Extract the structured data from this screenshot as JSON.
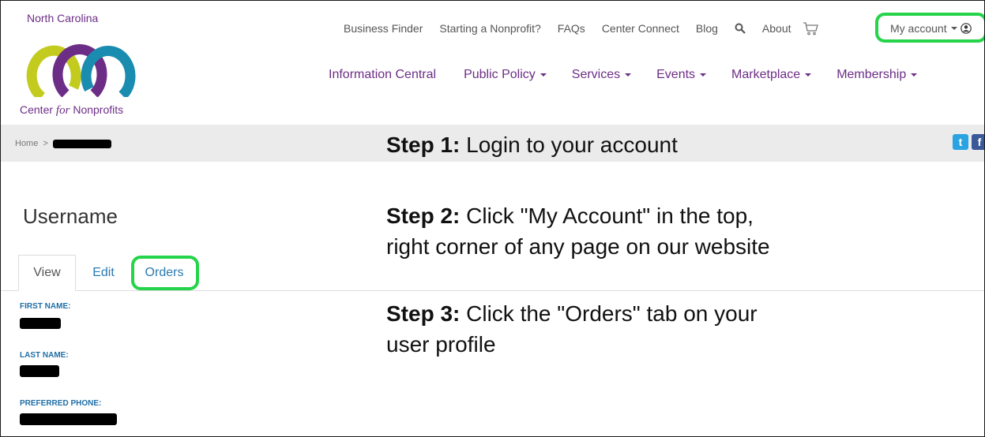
{
  "logo": {
    "top_text": "North Carolina",
    "bottom_prefix": "Center ",
    "bottom_italic": "for",
    "bottom_suffix": " Nonprofits",
    "colors": [
      "#c3cc1e",
      "#6c2d86",
      "#1a8cb0"
    ]
  },
  "util_nav": {
    "items": [
      "Business Finder",
      "Starting a Nonprofit?",
      "FAQs",
      "Center Connect",
      "Blog"
    ],
    "search_icon": "search-icon",
    "about": "About",
    "cart_icon": "cart-icon",
    "account": "My account",
    "account_icon": "user-icon"
  },
  "main_nav": {
    "items": [
      {
        "label": "Information Central",
        "dropdown": false
      },
      {
        "label": "Public Policy",
        "dropdown": true
      },
      {
        "label": "Services",
        "dropdown": true
      },
      {
        "label": "Events",
        "dropdown": true
      },
      {
        "label": "Marketplace",
        "dropdown": true
      },
      {
        "label": "Membership",
        "dropdown": true
      }
    ]
  },
  "breadcrumb": {
    "home": "Home",
    "separator": ">"
  },
  "social": {
    "twitter": "t",
    "facebook": "f"
  },
  "steps": {
    "step1_label": "Step 1:",
    "step1_text": " Login to your account",
    "step2_label": "Step 2:",
    "step2_line1": " Click \"My Account\" in the top,",
    "step2_line2": "right corner of any page on our website",
    "step3_label": "Step 3:",
    "step3_line1": " Click the \"Orders\" tab on your",
    "step3_line2": "user profile"
  },
  "profile": {
    "username": "Username",
    "tabs": [
      "View",
      "Edit",
      "Orders"
    ],
    "active_tab": "View",
    "fields": [
      "FIRST NAME:",
      "LAST NAME:",
      "PREFERRED PHONE:"
    ]
  },
  "colors": {
    "brand_purple": "#6c2d86",
    "link_blue": "#2a7ab0",
    "highlight_green": "#25d44a"
  }
}
